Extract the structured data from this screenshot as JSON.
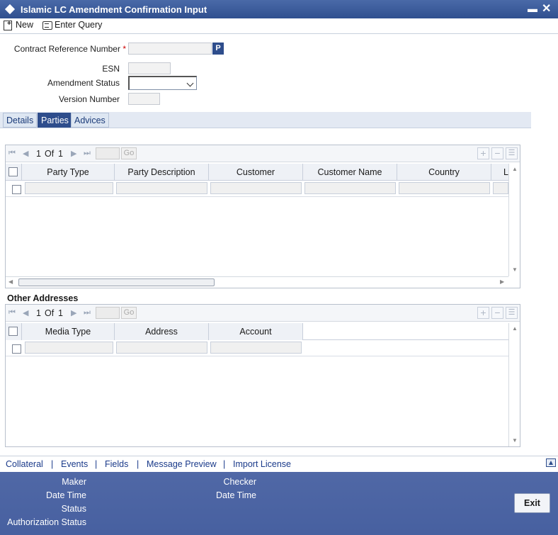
{
  "window": {
    "title": "Islamic LC Amendment Confirmation Input"
  },
  "toolbar": {
    "new_label": "New",
    "enter_query_label": "Enter Query"
  },
  "form": {
    "contract_ref_label": "Contract Reference Number",
    "required_mark": "*",
    "p_button": "P",
    "esn_label": "ESN",
    "amendment_status_label": "Amendment Status",
    "version_number_label": "Version Number"
  },
  "tabs": [
    {
      "label": "Details"
    },
    {
      "label": "Parties"
    },
    {
      "label": "Advices"
    }
  ],
  "parties_grid": {
    "pager": {
      "page": "1",
      "of_label": "Of",
      "total": "1",
      "go_label": "Go"
    },
    "columns": [
      "Party Type",
      "Party Description",
      "Customer",
      "Customer Name",
      "Country",
      "L"
    ]
  },
  "other_addresses": {
    "title": "Other Addresses",
    "pager": {
      "page": "1",
      "of_label": "Of",
      "total": "1",
      "go_label": "Go"
    },
    "columns": [
      "Media Type",
      "Address",
      "Account"
    ]
  },
  "links": [
    "Collateral",
    "Events",
    "Fields",
    "Message Preview",
    "Import License"
  ],
  "link_separator": "|",
  "footer": {
    "maker_label": "Maker",
    "date_time_label": "Date Time",
    "status_label": "Status",
    "authorization_status_label": "Authorization Status",
    "checker_label": "Checker",
    "checker_date_time_label": "Date Time",
    "exit_label": "Exit"
  },
  "icons": {
    "nav_first": "⏮",
    "nav_prev": "◀",
    "nav_next": "▶",
    "nav_last": "⏭",
    "add": "+",
    "remove": "−",
    "view": "☰",
    "minimize": "▬",
    "close": "✕"
  },
  "colors": {
    "titlebar": "#2f4f8f",
    "accent": "#2e4d8c",
    "footer": "#4a62a0",
    "link": "#1a3a8a"
  }
}
